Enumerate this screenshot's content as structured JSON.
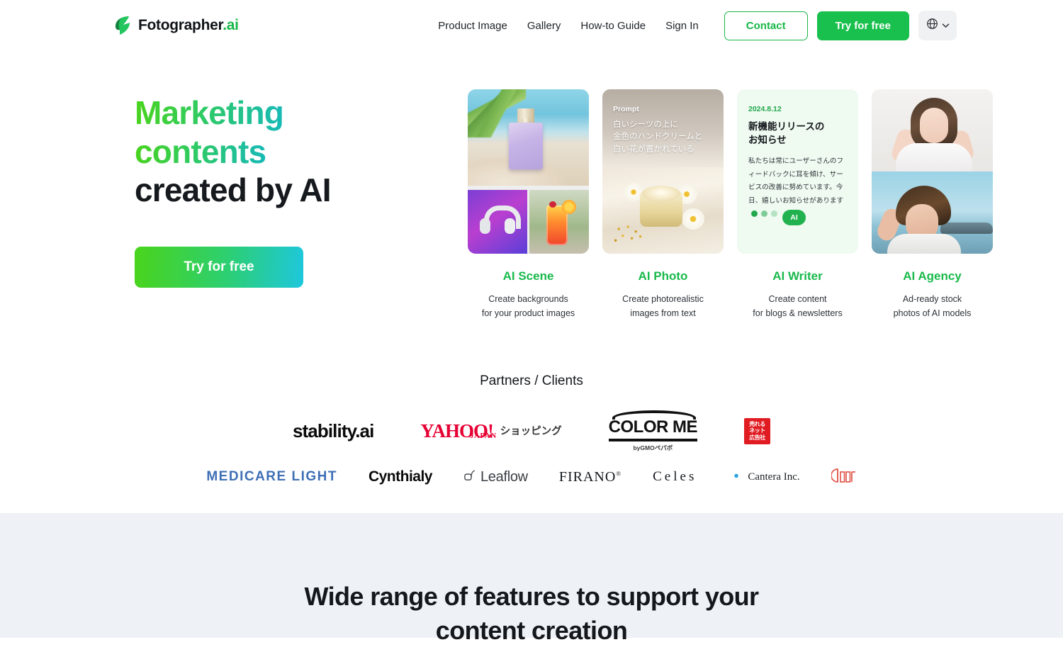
{
  "brand": {
    "name": "Fotographer",
    "suffix": ".ai",
    "logo_icon": "lightning-f-logo"
  },
  "nav": {
    "links": [
      {
        "label": "Product Image"
      },
      {
        "label": "Gallery"
      },
      {
        "label": "How-to Guide"
      },
      {
        "label": "Sign In"
      }
    ],
    "contact_label": "Contact",
    "try_label": "Try for free",
    "lang_icon": "globe-icon",
    "lang_chevron": "chevron-down-icon"
  },
  "hero": {
    "headline_line1": "Marketing",
    "headline_line2": "contents",
    "headline_line3": "created by AI",
    "cta_label": "Try for free"
  },
  "cards": [
    {
      "title": "AI Scene",
      "desc": "Create backgrounds\nfor your product images",
      "visual": "beach-perfume-headphones-cocktail"
    },
    {
      "title": "AI Photo",
      "desc": "Create photorealistic\nimages from text",
      "visual": "hand-cream-flowers",
      "prompt_label": "Prompt",
      "prompt_text": "白いシーツの上に\n金色のハンドクリームと\n白い花が置かれている"
    },
    {
      "title": "AI Writer",
      "desc": "Create content\nfor blogs & newsletters",
      "visual": "article-card",
      "date": "2024.8.12",
      "headline": "新機能リリースの\nお知らせ",
      "body": "私たちは常にユーザーさんのフィードバックに耳を傾け、サービスの改善に努めています。今日、嬉しいお知らせがあります",
      "badge": "AI"
    },
    {
      "title": "AI Agency",
      "desc": "Ad-ready stock\nphotos of AI models",
      "visual": "two-model-portraits"
    }
  ],
  "partners": {
    "title": "Partners / Clients",
    "row1": [
      {
        "name": "stability.ai"
      },
      {
        "name": "YAHOO! JAPAN ショッピング",
        "y1": "YAHOO!",
        "y2": "JAPAN",
        "y3": "ショッピング"
      },
      {
        "name": "COLOR ME",
        "cm": "COLOR ME",
        "gmo": "byGMOペパボ"
      },
      {
        "name": "売れるネット広告社",
        "l1": "売れる",
        "l2": "ネット",
        "l3": "広告社"
      }
    ],
    "row2": [
      {
        "name": "MEDICARE LIGHT"
      },
      {
        "name": "Cynthialy"
      },
      {
        "name": "Leaflow"
      },
      {
        "name": "FIRANO",
        "sup": "®"
      },
      {
        "name": "Celes"
      },
      {
        "name": "Cantera Inc."
      },
      {
        "name": "red-mark-logo"
      }
    ]
  },
  "features": {
    "title": "Wide range of features to support your\ncontent creation"
  },
  "colors": {
    "brand_green": "#17b748",
    "nav_green": "#19c04d",
    "gradient_start": "#4ad41b",
    "gradient_end": "#1ec7dd",
    "band_bg": "#eef2f6",
    "writer_card_bg": "#effaf1",
    "medicare_blue": "#3f6fb5",
    "yahoo_red": "#e60033"
  }
}
